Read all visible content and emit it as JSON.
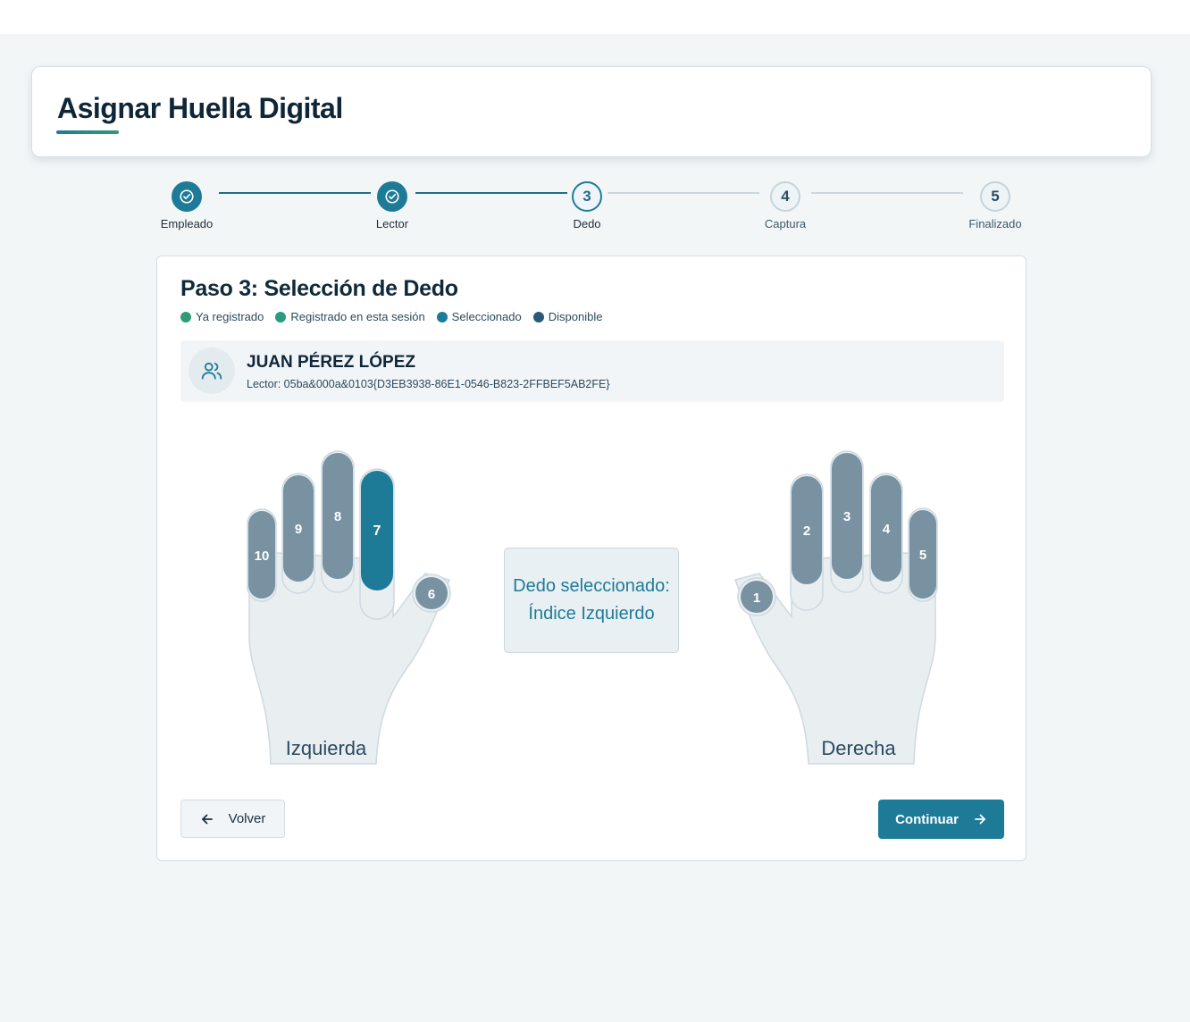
{
  "header": {
    "title": "Asignar Huella Digital"
  },
  "stepper": {
    "steps": [
      {
        "number": "1",
        "label": "Empleado",
        "state": "done"
      },
      {
        "number": "2",
        "label": "Lector",
        "state": "done"
      },
      {
        "number": "3",
        "label": "Dedo",
        "state": "current"
      },
      {
        "number": "4",
        "label": "Captura",
        "state": "todo"
      },
      {
        "number": "5",
        "label": "Finalizado",
        "state": "todo"
      }
    ]
  },
  "card": {
    "title": "Paso 3: Selección de Dedo",
    "legend": [
      {
        "label": "Ya registrado",
        "color": "#2e9a78"
      },
      {
        "label": "Registrado en esta sesión",
        "color": "#2a9a80"
      },
      {
        "label": "Seleccionado",
        "color": "#1e7b98"
      },
      {
        "label": "Disponible",
        "color": "#2a5a78"
      }
    ]
  },
  "employee": {
    "name": "JUAN PÉREZ LÓPEZ",
    "reader": "Lector: 05ba&000a&0103{D3EB3938-86E1-0546-B823-2FFBEF5AB2FE}",
    "icon": "users-icon"
  },
  "hands": {
    "left": {
      "label": "Izquierda",
      "fingers": [
        {
          "number": "10",
          "state": "disponible"
        },
        {
          "number": "9",
          "state": "disponible"
        },
        {
          "number": "8",
          "state": "disponible"
        },
        {
          "number": "7",
          "state": "seleccionado"
        },
        {
          "number": "6",
          "state": "disponible"
        }
      ]
    },
    "right": {
      "label": "Derecha",
      "fingers": [
        {
          "number": "1",
          "state": "disponible"
        },
        {
          "number": "2",
          "state": "disponible"
        },
        {
          "number": "3",
          "state": "disponible"
        },
        {
          "number": "4",
          "state": "disponible"
        },
        {
          "number": "5",
          "state": "disponible"
        }
      ]
    }
  },
  "selection": {
    "text": "Dedo seleccionado: Índice Izquierdo"
  },
  "buttons": {
    "back": {
      "label": "Volver",
      "icon": "arrow-left-icon"
    },
    "next": {
      "label": "Continuar",
      "icon": "arrow-right-icon"
    }
  },
  "colors": {
    "accent": "#1e7b98",
    "finger_available": "#7892a2",
    "finger_selected": "#1e7b98",
    "hand_fill": "#e9eef1"
  }
}
